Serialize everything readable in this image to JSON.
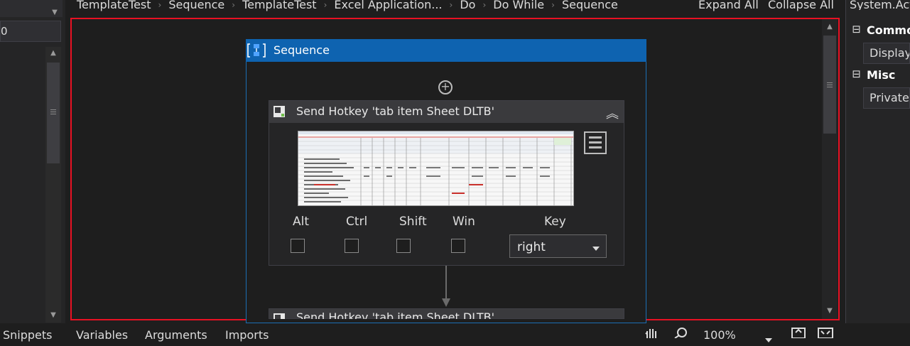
{
  "breadcrumb": [
    "TemplateTest",
    "Sequence",
    "TemplateTest",
    "Excel Application...",
    "Do",
    "Do While",
    "Sequence"
  ],
  "breadcrumb_sep": "›",
  "toolbar": {
    "expand_all": "Expand All",
    "collapse_all": "Collapse All"
  },
  "left_panel": {
    "input_value": "0"
  },
  "sequence": {
    "title": "Sequence",
    "add_symbol": "+"
  },
  "activity": {
    "title": "Send Hotkey 'tab item  Sheet DLTB'",
    "modifiers": [
      "Alt",
      "Ctrl",
      "Shift",
      "Win"
    ],
    "key_label": "Key",
    "key_value": "right",
    "collapse_symbol": "︽"
  },
  "activity2": {
    "title": "Send Hotkey 'tab item  Sheet DLTB'"
  },
  "properties": {
    "title": "System.Activ",
    "categories": [
      {
        "name": "Common",
        "toggle": "⊟",
        "row": "DisplayName"
      },
      {
        "name": "Misc",
        "toggle": "⊟",
        "row": "Private"
      }
    ]
  },
  "bottom_tabs": {
    "snippets": "Snippets",
    "variables": "Variables",
    "arguments": "Arguments",
    "imports": "Imports"
  },
  "zoom": {
    "value": "100%"
  },
  "icons": {
    "hand": "hand-icon",
    "search": "zoom-search-icon",
    "fit": "fit-screen-icon",
    "overview": "overview-icon"
  },
  "colors": {
    "accent": "#0e63b0",
    "selection_border": "#e81123"
  }
}
